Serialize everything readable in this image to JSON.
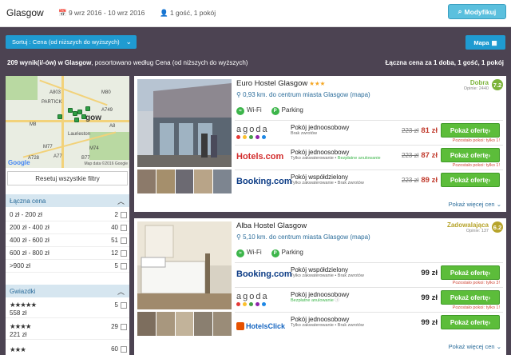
{
  "header": {
    "city": "Glasgow",
    "dates": "9 wrz 2016 - 10 wrz 2016",
    "guests": "1 gość, 1 pokój",
    "modify_label": "Modyfikuj"
  },
  "toolbar": {
    "sort_label": "Sortuj : Cena (od niższych do wyższych)",
    "map_label": "Mapa"
  },
  "results": {
    "count": "209 wynik(i/-ów) w Glasgow",
    "sorted_text": ", posortowano według Cena (od niższych do wyższych)",
    "total_price_note": "Łączna cena za 1 doba, 1 gość, 1 pokój"
  },
  "map": {
    "labels": [
      "PARTICK",
      "gow",
      "Laurieston",
      "M8",
      "M77",
      "M74",
      "A8",
      "A77",
      "A803",
      "M80",
      "A749",
      "A728",
      "B77"
    ],
    "copyright": "Map data ©2016 Google",
    "google": "Google"
  },
  "filters": {
    "reset_label": "Resetuj wszystkie filtry",
    "price_header": "Łączna cena",
    "price_ranges": [
      {
        "label": "0 zł - 200 zł",
        "count": "2"
      },
      {
        "label": "200 zł - 400 zł",
        "count": "40"
      },
      {
        "label": "400 zł - 600 zł",
        "count": "51"
      },
      {
        "label": "600 zł - 800 zł",
        "count": "12"
      },
      {
        "label": ">900 zł",
        "count": "5"
      }
    ],
    "stars_header": "Gwiazdki",
    "star_rows": [
      {
        "stars": "★★★★★",
        "count": "5",
        "price": "558 zł"
      },
      {
        "stars": "★★★★",
        "count": "29",
        "price": "221 zł"
      },
      {
        "stars": "★★★",
        "count": "60"
      }
    ]
  },
  "hotels": [
    {
      "name": "Euro Hostel Glasgow",
      "stars": "★★★",
      "distance": "0,93 km. do centrum miasta Glasgow (mapa)",
      "amenities": [
        "Wi-Fi",
        "Parking"
      ],
      "rating_word": "Dobra",
      "rating_score": "7.2",
      "opinions": "Opinie: 2440",
      "offers": [
        {
          "provider": "agoda",
          "room": "Pokój jednoosobowy",
          "sub": "Brak zwrotów",
          "sub2": "",
          "old_price": "223 zł",
          "price": "81 zł",
          "button": "Pokaż ofertę",
          "note": "Pozostało pokoi: tylko 1!"
        },
        {
          "provider": "Hotels.com",
          "room": "Pokój jednoosobowy",
          "sub": "Tylko zakwaterowanie • ",
          "sub2": "Bezpłatne anulowanie",
          "old_price": "223 zł",
          "price": "87 zł",
          "button": "Pokaż ofertę",
          "note": "Pozostało pokoi: tylko 1!"
        },
        {
          "provider": "Booking.com",
          "room": "Pokój współdzielony",
          "sub": "Tylko zakwaterowanie • Brak zwrotów",
          "sub2": "",
          "old_price": "223 zł",
          "price": "89 zł",
          "button": "Pokaż ofertę",
          "note": ""
        }
      ],
      "more": "Pokaż więcej cen"
    },
    {
      "name": "Alba Hostel Glasgow",
      "stars": "",
      "distance": "5,10 km. do centrum miasta Glasgow (mapa)",
      "amenities": [
        "Wi-Fi",
        "Parking"
      ],
      "rating_word": "Zadowalająca",
      "rating_score": "6.2",
      "opinions": "Opinie: 137",
      "offers": [
        {
          "provider": "Booking.com",
          "room": "Pokój współdzielony",
          "sub": "Tylko zakwaterowanie • Brak zwrotów",
          "sub2": "",
          "old_price": "",
          "price": "99 zł",
          "button": "Pokaż ofertę",
          "note": "Pozostało pokoi: tylko 3!"
        },
        {
          "provider": "agoda",
          "room": "Pokój jednoosobowy",
          "sub": "",
          "sub2": "Bezpłatne anulowanie",
          "old_price": "",
          "price": "99 zł",
          "button": "Pokaż ofertę",
          "note": "Pozostało pokoi: tylko 1!"
        },
        {
          "provider": "HotelsClick",
          "room": "Pokój jednoosobowy",
          "sub": "Tylko zakwaterowanie • Brak zwrotów",
          "sub2": "",
          "old_price": "",
          "price": "99 zł",
          "button": "Pokaż ofertę",
          "note": ""
        }
      ],
      "more": "Pokaż więcej cen"
    }
  ],
  "colors": {
    "accent_blue": "#1f9bd1",
    "button_green": "#5cbd3a",
    "rating_green": "#7cb33a",
    "rating_olive": "#b7a42b",
    "panel_bg": "#4c4352"
  }
}
